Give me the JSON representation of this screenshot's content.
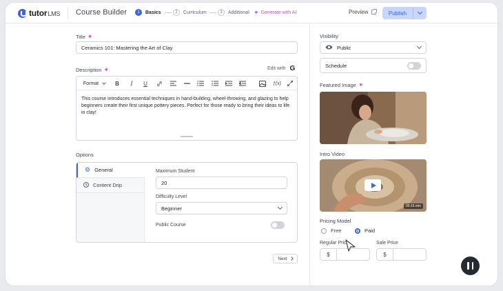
{
  "header": {
    "logo_text": "tutor",
    "logo_sub": "LMS",
    "title": "Course Builder",
    "steps": [
      {
        "num": "1",
        "label": "Basics"
      },
      {
        "num": "2",
        "label": "Curriculum"
      },
      {
        "num": "3",
        "label": "Additional"
      }
    ],
    "ai_label": "Generate with AI",
    "preview_label": "Preview",
    "publish_label": "Publish"
  },
  "colors": {
    "accent": "#3e64de",
    "ai": "#c152d6",
    "publish_bg": "#c9d6fb"
  },
  "main": {
    "title_label": "Title",
    "title_value": "Ceramics 101: Mastering the Art of Clay",
    "description_label": "Description",
    "edit_with_label": "Edit with",
    "format_label": "Format",
    "description_text": "This course introduces essential techniques in hand-building, wheel-throwing, and glazing to help beginners create their first unique pottery pieces. Perfect for those ready to bring their ideas to life in clay!",
    "toolbar_icons": [
      "bold-icon",
      "italic-icon",
      "underline-icon",
      "link-icon",
      "align-icon",
      "horizontal-rule-icon",
      "bullet-list-icon",
      "numbered-list-icon",
      "indent-icon",
      "outdent-icon",
      "image-icon",
      "formula-icon",
      "fullscreen-icon"
    ]
  },
  "options": {
    "label": "Options",
    "tabs": [
      "General",
      "Content Drip"
    ],
    "max_student_label": "Maximum Student",
    "max_student_value": "20",
    "difficulty_label": "Difficulty Level",
    "difficulty_value": "Beginner",
    "public_course_label": "Public Course",
    "public_course_on": false,
    "next_label": "Next"
  },
  "sidebar": {
    "visibility_label": "Visibility",
    "visibility_value": "Public",
    "schedule_label": "Schedule",
    "schedule_on": false,
    "featured_image_label": "Featured Image",
    "intro_video_label": "Intro Video",
    "video_duration": "00:16 min",
    "pricing_label": "Pricing Model",
    "pricing_options": [
      "Free",
      "Paid"
    ],
    "pricing_selected": "Paid",
    "regular_price_label": "Regular Price",
    "sale_price_label": "Sale Price",
    "currency": "$",
    "regular_price_value": "",
    "sale_price_value": ""
  }
}
